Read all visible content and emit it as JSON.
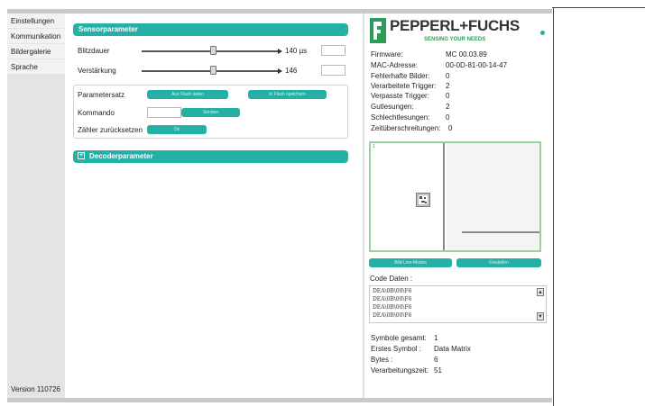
{
  "sidebar": {
    "items": [
      {
        "label": "Einstellungen"
      },
      {
        "label": "Kommunikation"
      },
      {
        "label": "Bildergalerie"
      },
      {
        "label": "Sprache"
      }
    ],
    "version": "Version 110726"
  },
  "sensor": {
    "header": "Sensorparameter",
    "blitzdauer": {
      "label": "Blitzdauer",
      "value": "140 µs",
      "level": 0.52
    },
    "verstaerkung": {
      "label": "Verstärkung",
      "value": "146",
      "level": 0.52
    },
    "parametersatz_label": "Parametersatz",
    "parametersatz_load": "Aus Flash laden",
    "parametersatz_save": "In Flash speichern",
    "kommando_label": "Kommando",
    "kommando_send": "Senden",
    "zaehler_label": "Zähler zurücksetzen",
    "zaehler_ok": "Ok"
  },
  "decoder": {
    "header": "Decoderparameter",
    "toggle": "+"
  },
  "brand": {
    "name": "PEPPERL+FUCHS",
    "tagline": "SENSING YOUR NEEDS",
    "logo_color": "#2e9c59",
    "accent": "#25b0a6"
  },
  "info": [
    {
      "label": "Firmware:",
      "value": "MC 00.03.89"
    },
    {
      "label": "MAC-Adresse:",
      "value": "00-0D-81-00-14-47"
    },
    {
      "label": "Fehlerhafte Bilder:",
      "value": "0"
    },
    {
      "label": "Verarbeitete Trigger:",
      "value": "2"
    },
    {
      "label": "Verpasste Trigger:",
      "value": "0"
    },
    {
      "label": "Gutlesungen:",
      "value": "2"
    },
    {
      "label": "Schlechtlesungen:",
      "value": "0"
    },
    {
      "label": "Zeitüberschreitungen:",
      "value": "0"
    }
  ],
  "image": {
    "corner_label": "1",
    "buttons": [
      "Bild-Live-Modus",
      "Einstellen"
    ]
  },
  "code": {
    "label": "Code Daten :",
    "lines": [
      "DEA\\0B\\00\\F6",
      "DEA\\0B\\00\\F6",
      "DEA\\0B\\00\\F6",
      "DEA\\0B\\00\\F6"
    ]
  },
  "stats": [
    {
      "label": "Symbole gesamt:",
      "value": "1"
    },
    {
      "label": "Erstes Symbol :",
      "value": "Data Matrix"
    },
    {
      "label": "Bytes :",
      "value": "6"
    },
    {
      "label": "Verarbeitungszeit:",
      "value": "51"
    }
  ]
}
